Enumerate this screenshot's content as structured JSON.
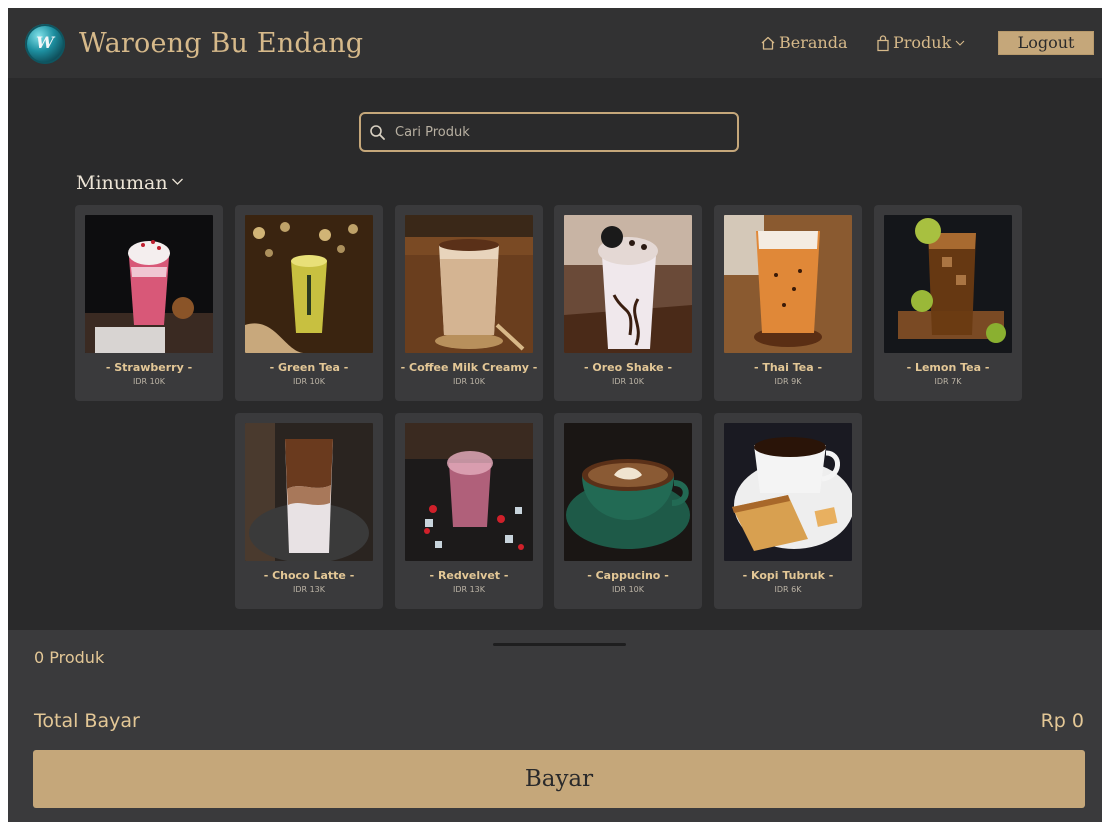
{
  "header": {
    "brand": "Waroeng Bu Endang",
    "nav": {
      "beranda": "Beranda",
      "produk": "Produk"
    },
    "logout": "Logout"
  },
  "search": {
    "placeholder": "Cari Produk",
    "value": ""
  },
  "category": {
    "label": "Minuman"
  },
  "products": [
    {
      "name": "- Strawberry -",
      "price": "IDR 10K"
    },
    {
      "name": "- Green Tea -",
      "price": "IDR 10K"
    },
    {
      "name": "- Coffee Milk Creamy -",
      "price": "IDR 10K"
    },
    {
      "name": "- Oreo Shake -",
      "price": "IDR 10K"
    },
    {
      "name": "- Thai Tea -",
      "price": "IDR 9K"
    },
    {
      "name": "- Lemon Tea -",
      "price": "IDR 7K"
    },
    {
      "name": "- Choco Latte -",
      "price": "IDR 13K"
    },
    {
      "name": "- Redvelvet -",
      "price": "IDR 13K"
    },
    {
      "name": "- Cappucino -",
      "price": "IDR 10K"
    },
    {
      "name": "- Kopi Tubruk -",
      "price": "IDR 6K"
    }
  ],
  "cart": {
    "count_label": "0 Produk",
    "total_label": "Total Bayar",
    "total_value": "Rp 0",
    "pay_label": "Bayar"
  },
  "colors": {
    "accent": "#c5a77a",
    "background": "#2a2a2b",
    "card": "#3a3a3c",
    "text_gold": "#e3c796"
  }
}
